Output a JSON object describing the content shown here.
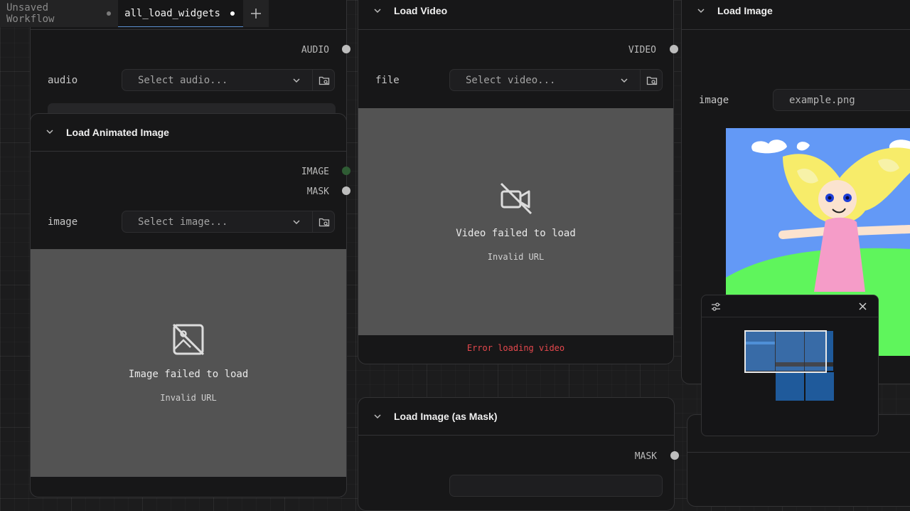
{
  "tabs": [
    {
      "label": "Unsaved Workflow",
      "active": false
    },
    {
      "label": "all_load_widgets",
      "active": true
    }
  ],
  "nodes": {
    "load_audio": {
      "output": "AUDIO",
      "field_label": "audio",
      "placeholder": "Select audio..."
    },
    "load_animated_image": {
      "title": "Load Animated Image",
      "outputs": [
        "IMAGE",
        "MASK"
      ],
      "field_label": "image",
      "placeholder": "Select image...",
      "preview_title": "Image failed to load",
      "preview_sub": "Invalid URL"
    },
    "load_video": {
      "title": "Load Video",
      "output": "VIDEO",
      "field_label": "file",
      "placeholder": "Select video...",
      "preview_title": "Video failed to load",
      "preview_sub": "Invalid URL",
      "error": "Error loading video"
    },
    "load_image": {
      "title": "Load Image",
      "field_label": "image",
      "value": "example.png"
    },
    "load_image_mask": {
      "title": "Load Image (as Mask)",
      "output": "MASK"
    }
  },
  "icons": {
    "chevron": "chevron-down-icon",
    "folder": "folder-search-icon",
    "image_off": "image-off-icon",
    "video_off": "video-off-icon",
    "settings": "sliders-icon",
    "close": "close-icon"
  },
  "colors": {
    "accent": "#5a8fd0",
    "error": "#e5484d",
    "socket": "#bdbdbd",
    "socket_connected": "#2f5c34"
  }
}
